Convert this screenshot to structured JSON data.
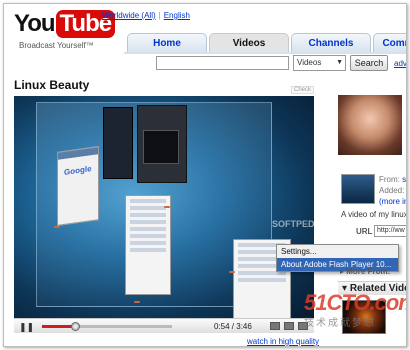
{
  "header": {
    "logo_you": "You",
    "logo_tube": "Tube",
    "tagline": "Broadcast Yourself™",
    "region": "Worldwide (All)",
    "language": "English"
  },
  "tabs": [
    {
      "label": "Home"
    },
    {
      "label": "Videos"
    },
    {
      "label": "Channels"
    },
    {
      "label": "Comm"
    }
  ],
  "search": {
    "value": "",
    "category": "Videos",
    "button": "Search",
    "advanced": "adv"
  },
  "video": {
    "title": "Linux Beauty",
    "flag": "Check",
    "time": "0:54 / 3:46",
    "progress": 0.25,
    "hq_link": "watch in high quality",
    "overlay_text": "SOFTPEDIA"
  },
  "context_menu": {
    "items": [
      "Settings...",
      "About Adobe Flash Player 10..."
    ],
    "highlighted": 1
  },
  "sidebar": {
    "from_label": "From:",
    "from_user": "sa",
    "added_label": "Added: F",
    "more_info": "(more info",
    "description": "A video of my linux",
    "url_label": "URL",
    "url_value": "http://ww",
    "more_from": "▸ More From:",
    "related": "Related Vide"
  },
  "watermark": {
    "main": "51CTO.com",
    "sub": "技术成就梦想"
  },
  "colors": {
    "brand_red": "#d80a0a",
    "link_blue": "#0033cc",
    "menu_highlight": "#3166b6"
  }
}
